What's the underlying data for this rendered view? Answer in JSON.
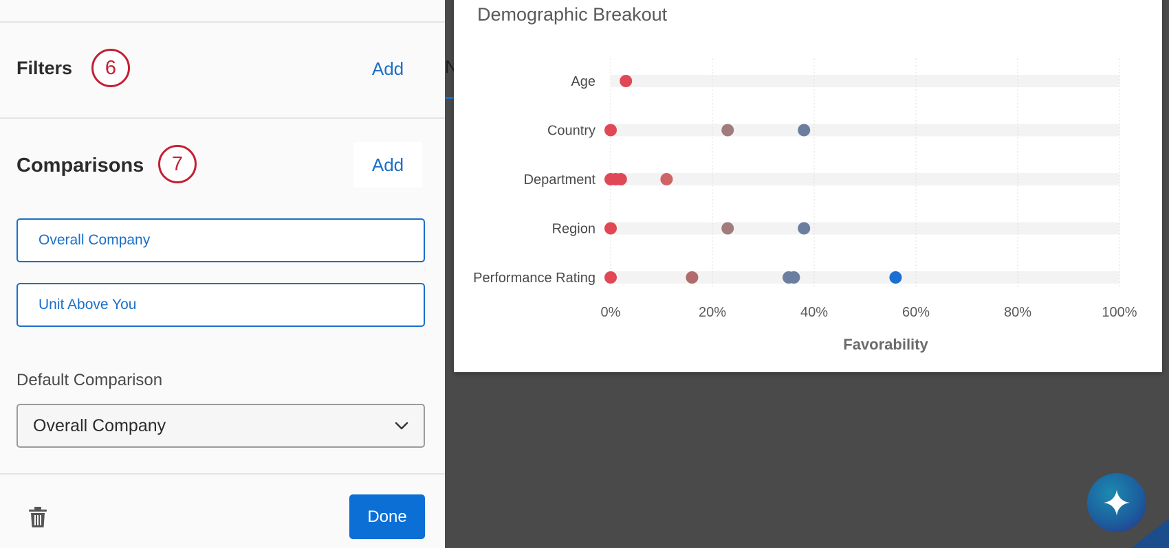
{
  "left_panel": {
    "filters": {
      "title": "Filters",
      "step": "6",
      "add_label": "Add"
    },
    "comparisons": {
      "title": "Comparisons",
      "step": "7",
      "add_label": "Add",
      "items": [
        "Overall Company",
        "Unit Above You"
      ]
    },
    "default_comparison": {
      "label": "Default Comparison",
      "value": "Overall Company"
    },
    "delete_icon": "trash-icon",
    "done_label": "Done"
  },
  "background": {
    "peek_text": "N"
  },
  "chart_data": {
    "type": "scatter",
    "title": "Demographic Breakout",
    "xlabel": "Favorability",
    "ylabel": "",
    "xlim": [
      0,
      100
    ],
    "x_ticks": [
      "0%",
      "20%",
      "40%",
      "60%",
      "80%",
      "100%"
    ],
    "categories": [
      "Age",
      "Country",
      "Department",
      "Region",
      "Performance Rating"
    ],
    "grid": "vertical dotted",
    "points": [
      {
        "category": "Age",
        "x": 3,
        "color": "#e04856"
      },
      {
        "category": "Country",
        "x": 0,
        "color": "#e04856"
      },
      {
        "category": "Country",
        "x": 23,
        "color": "#a07c7c"
      },
      {
        "category": "Country",
        "x": 38,
        "color": "#6b7ea0"
      },
      {
        "category": "Department",
        "x": 0,
        "color": "#e04856"
      },
      {
        "category": "Department",
        "x": 1,
        "color": "#e04856"
      },
      {
        "category": "Department",
        "x": 2,
        "color": "#e04856"
      },
      {
        "category": "Department",
        "x": 11,
        "color": "#cf6467"
      },
      {
        "category": "Region",
        "x": 0,
        "color": "#e04856"
      },
      {
        "category": "Region",
        "x": 23,
        "color": "#a07c7c"
      },
      {
        "category": "Region",
        "x": 38,
        "color": "#6b7ea0"
      },
      {
        "category": "Performance Rating",
        "x": 0,
        "color": "#e04856"
      },
      {
        "category": "Performance Rating",
        "x": 16,
        "color": "#b06c6c"
      },
      {
        "category": "Performance Rating",
        "x": 35,
        "color": "#6b7ea0"
      },
      {
        "category": "Performance Rating",
        "x": 36,
        "color": "#6b7ea0"
      },
      {
        "category": "Performance Rating",
        "x": 56,
        "color": "#1a6fd0"
      }
    ]
  },
  "fab": {
    "icon": "sparkle-icon"
  },
  "colors": {
    "accent": "#1a6fc9",
    "badge": "#c41f33",
    "done_button": "#0b6fd6",
    "overlay": "#4a4a4a"
  }
}
